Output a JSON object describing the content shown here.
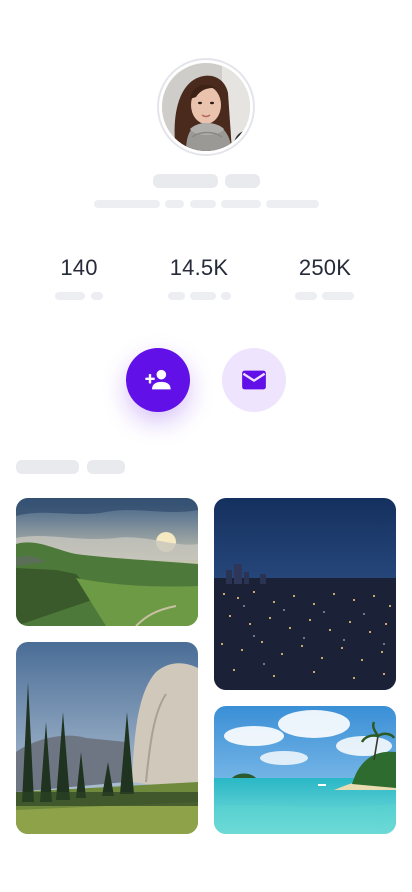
{
  "profile": {
    "stats": [
      {
        "value": "140"
      },
      {
        "value": "14.5K"
      },
      {
        "value": "250K"
      }
    ]
  },
  "actions": {
    "follow_icon": "person-add-icon",
    "message_icon": "mail-icon"
  },
  "gallery": {
    "photos": [
      {
        "name": "mountain-valley-sunset"
      },
      {
        "name": "city-lights-night"
      },
      {
        "name": "granite-cliff-forest"
      },
      {
        "name": "tropical-beach"
      }
    ]
  },
  "colors": {
    "accent": "#6210e8",
    "accent_light": "#efe4fd",
    "skeleton": "#e8eaee",
    "text": "#262b3a"
  }
}
